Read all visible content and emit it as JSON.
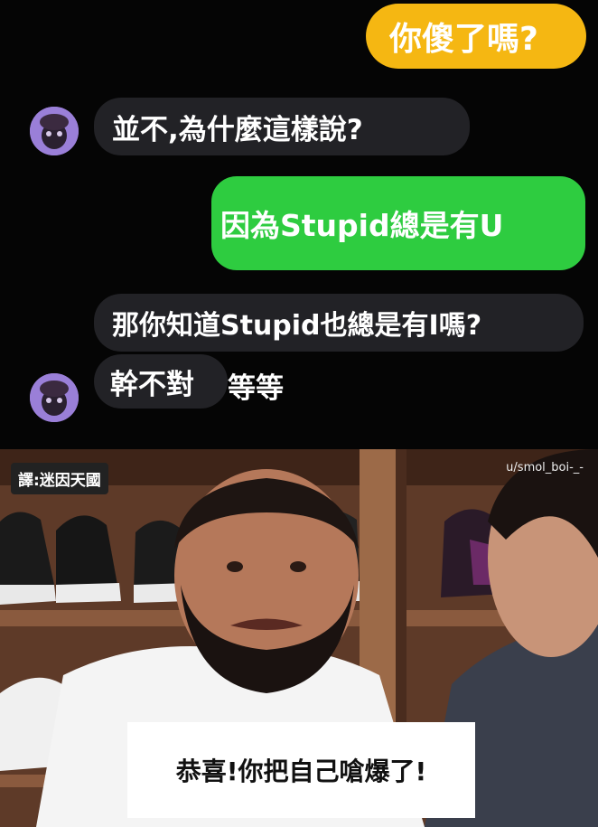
{
  "chat": {
    "messages": [
      {
        "side": "right",
        "text": "你傻了嗎?"
      },
      {
        "side": "left",
        "text": "並不,為什麼這樣說?"
      },
      {
        "side": "right",
        "text": "因為Stupid總是有U"
      },
      {
        "side": "left",
        "text": "那你知道Stupid也總是有I嗎?"
      },
      {
        "side": "left",
        "text": "幹不對",
        "text_after": "等等"
      }
    ]
  },
  "photo": {
    "translator_tag": "譯:迷因天國",
    "credit": "u/smol_boi-_-",
    "caption": "恭喜!你把自己嗆爆了!"
  },
  "colors": {
    "yellow_bubble": "#f5b712",
    "green_bubble": "#2ecc40",
    "dark_bubble": "#222226",
    "avatar": "#9a7fd8"
  }
}
